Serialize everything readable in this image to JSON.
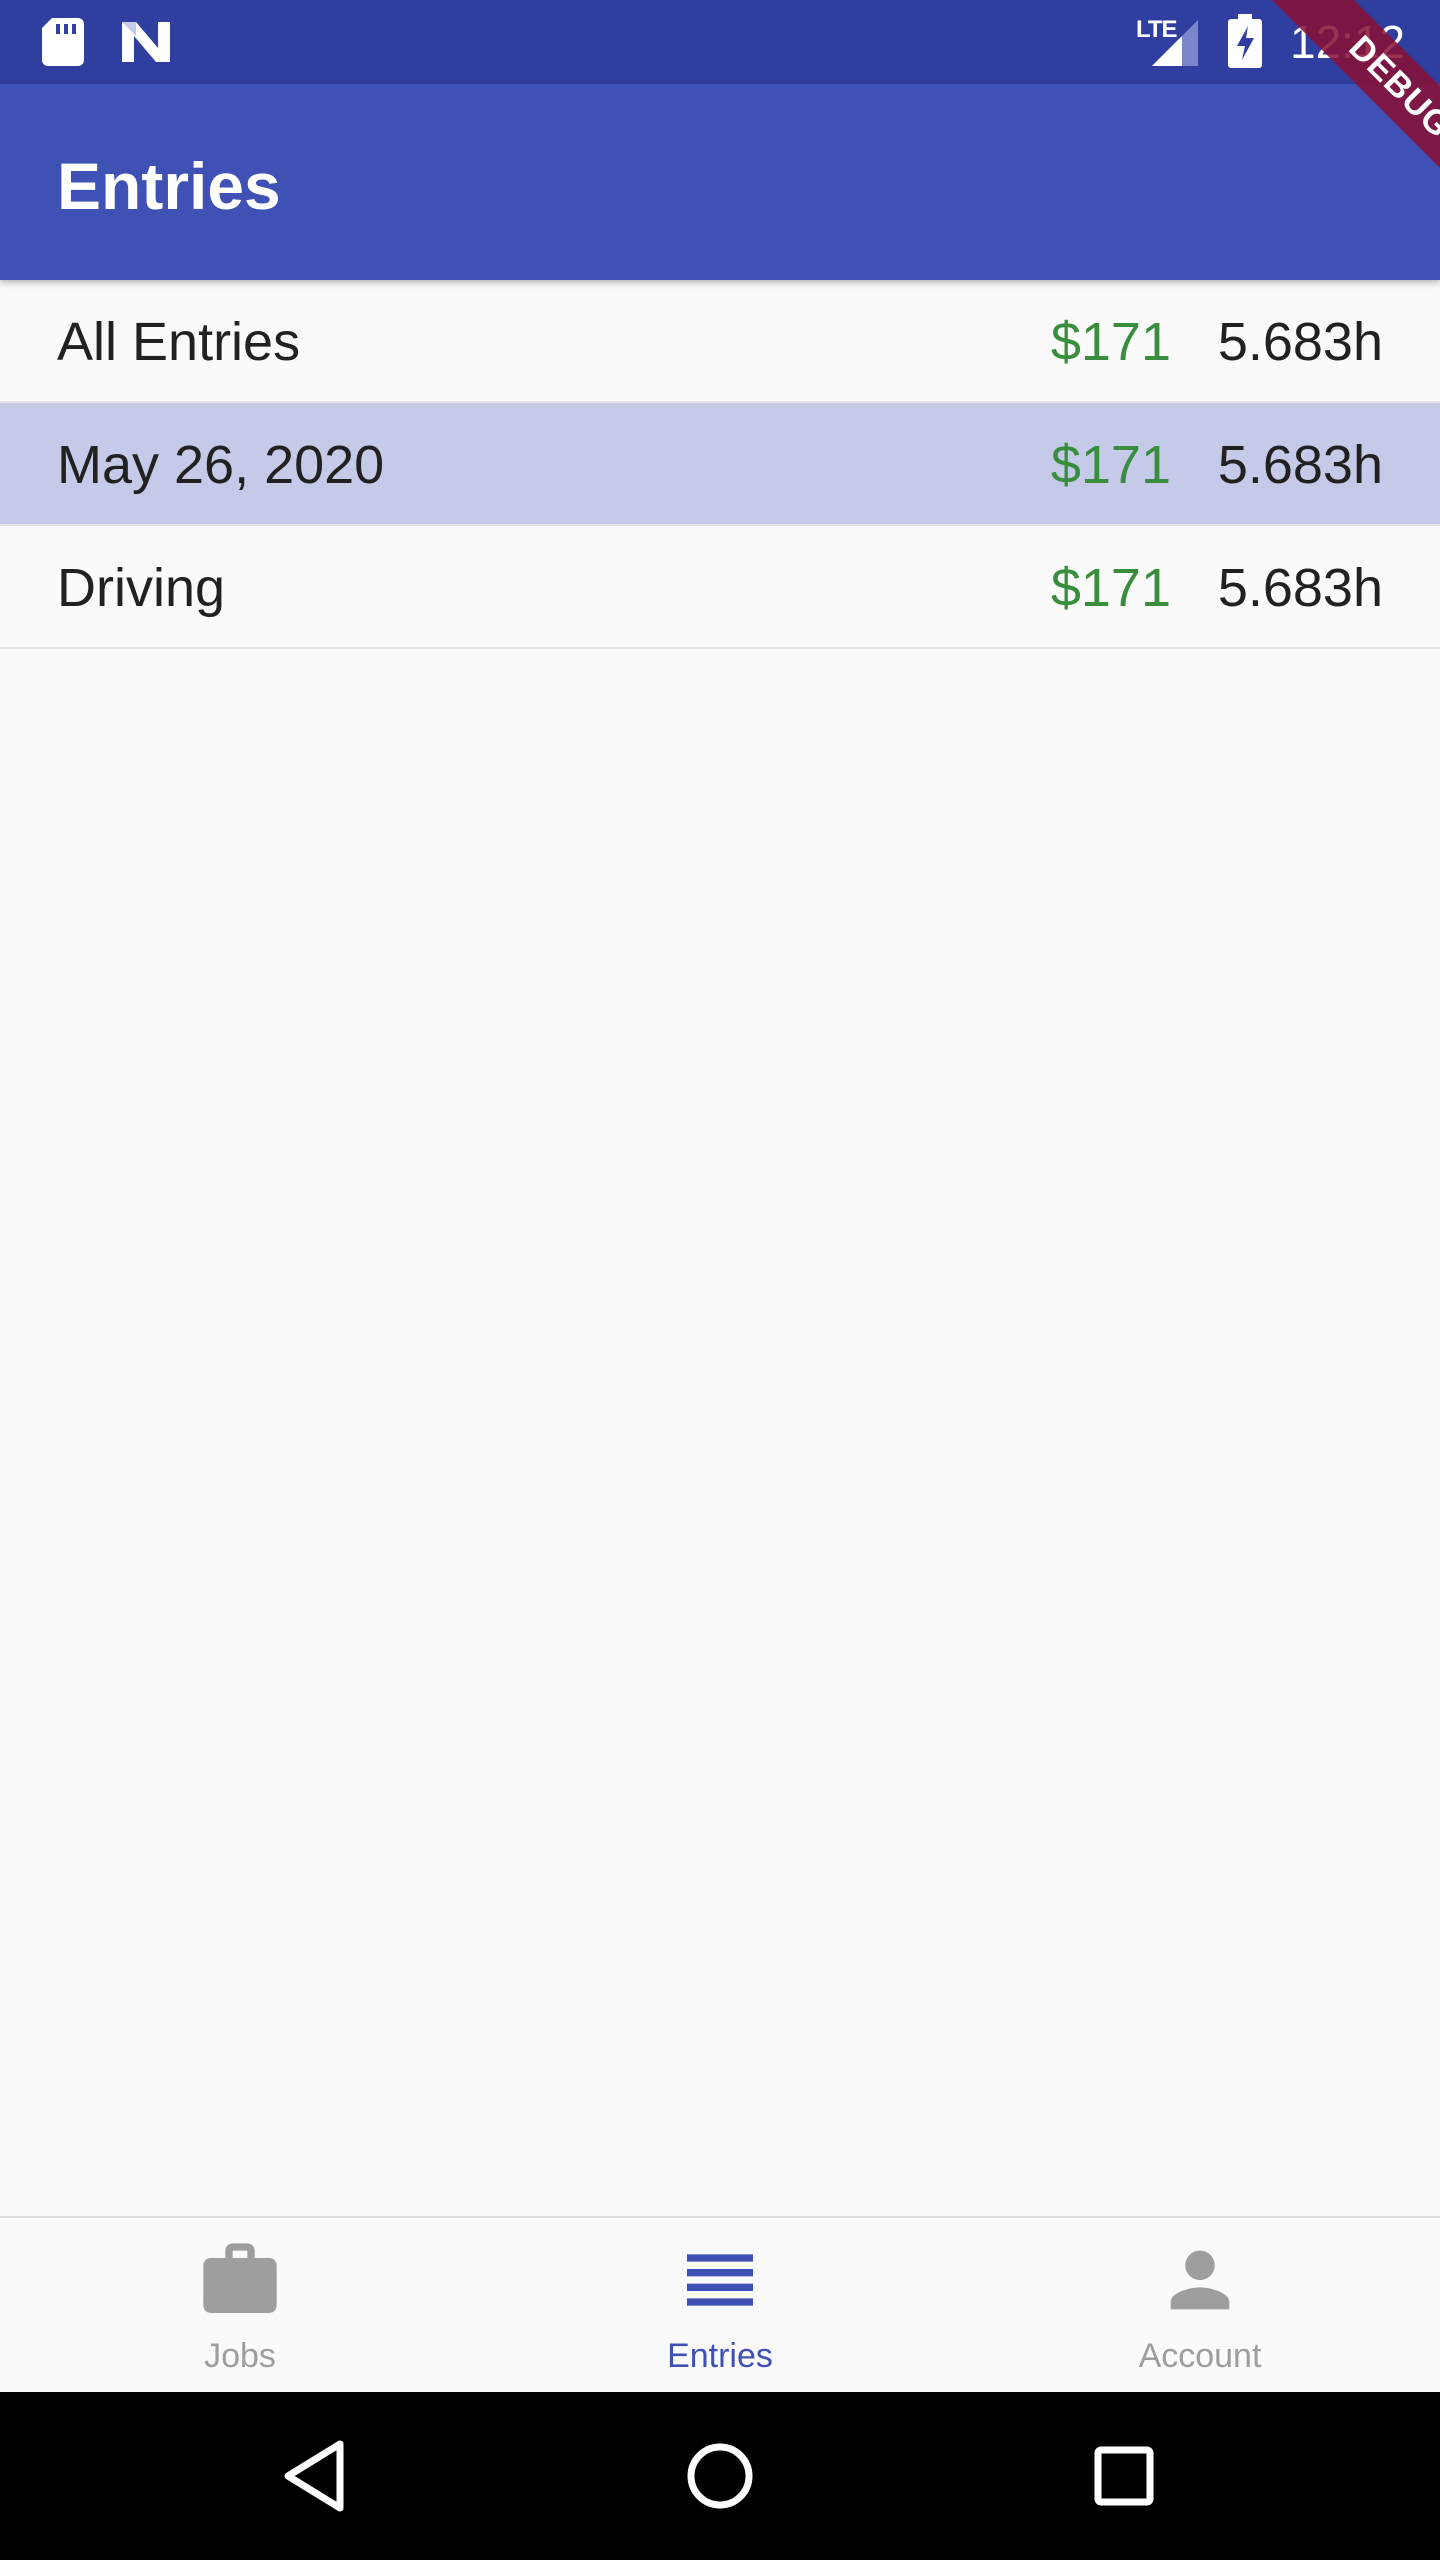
{
  "status_bar": {
    "time": "12:12",
    "network": "LTE",
    "icons": [
      "sd-card-icon",
      "n-notification-icon",
      "signal-icon",
      "battery-charging-icon"
    ]
  },
  "debug_banner": "DEBUG",
  "app_bar": {
    "title": "Entries"
  },
  "entries": [
    {
      "label": "All Entries",
      "pay": "$171",
      "hours": "5.683h",
      "selected": false
    },
    {
      "label": "May 26, 2020",
      "pay": "$171",
      "hours": "5.683h",
      "selected": true
    },
    {
      "label": "Driving",
      "pay": "$171",
      "hours": "5.683h",
      "selected": false
    }
  ],
  "bottom_nav": {
    "items": [
      {
        "label": "Jobs",
        "icon": "briefcase-icon",
        "active": false
      },
      {
        "label": "Entries",
        "icon": "list-icon",
        "active": true
      },
      {
        "label": "Account",
        "icon": "person-icon",
        "active": false
      }
    ]
  },
  "system_nav": {
    "icons": [
      "back-icon",
      "home-icon",
      "recents-icon"
    ]
  },
  "colors": {
    "status_bar": "#303f9f",
    "primary": "#3f51b5",
    "selected_row": "#c5cae9",
    "pay_green": "#388e3c",
    "inactive_nav": "#9e9e9e",
    "debug_banner": "#880e33"
  }
}
